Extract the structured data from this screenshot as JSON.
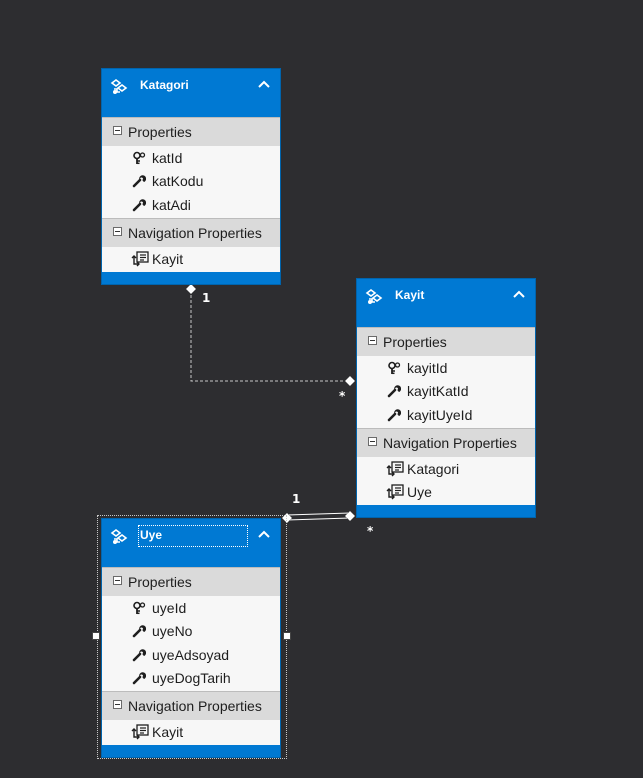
{
  "entities": {
    "katagori": {
      "name": "Katagori",
      "icon": "entity-icon",
      "properties_label": "Properties",
      "properties": [
        {
          "name": "katId",
          "icon": "key-icon"
        },
        {
          "name": "katKodu",
          "icon": "wrench-icon"
        },
        {
          "name": "katAdi",
          "icon": "wrench-icon"
        }
      ],
      "nav_label": "Navigation Properties",
      "nav_properties": [
        {
          "name": "Kayit",
          "icon": "navigation-property-icon"
        }
      ]
    },
    "kayit": {
      "name": "Kayit",
      "icon": "entity-icon",
      "properties_label": "Properties",
      "properties": [
        {
          "name": "kayitId",
          "icon": "key-icon"
        },
        {
          "name": "kayitKatId",
          "icon": "wrench-icon"
        },
        {
          "name": "kayitUyeId",
          "icon": "wrench-icon"
        }
      ],
      "nav_label": "Navigation Properties",
      "nav_properties": [
        {
          "name": "Katagori",
          "icon": "navigation-property-icon"
        },
        {
          "name": "Uye",
          "icon": "navigation-property-icon"
        }
      ]
    },
    "uye": {
      "name": "Uye",
      "icon": "entity-icon",
      "properties_label": "Properties",
      "properties": [
        {
          "name": "uyeId",
          "icon": "key-icon"
        },
        {
          "name": "uyeNo",
          "icon": "wrench-icon"
        },
        {
          "name": "uyeAdsoyad",
          "icon": "wrench-icon"
        },
        {
          "name": "uyeDogTarih",
          "icon": "wrench-icon"
        }
      ],
      "nav_label": "Navigation Properties",
      "nav_properties": [
        {
          "name": "Kayit",
          "icon": "navigation-property-icon"
        }
      ]
    }
  },
  "associations": {
    "katagori_kayit": {
      "from_mult": "1",
      "to_mult": "*"
    },
    "uye_kayit": {
      "from_mult": "1",
      "to_mult": "*"
    }
  },
  "colors": {
    "canvas": "#2d2d30",
    "entity_header": "#0079d3",
    "section_header": "#dadada",
    "section_body": "#f7f7f7",
    "connector": "#c8c8c8"
  }
}
